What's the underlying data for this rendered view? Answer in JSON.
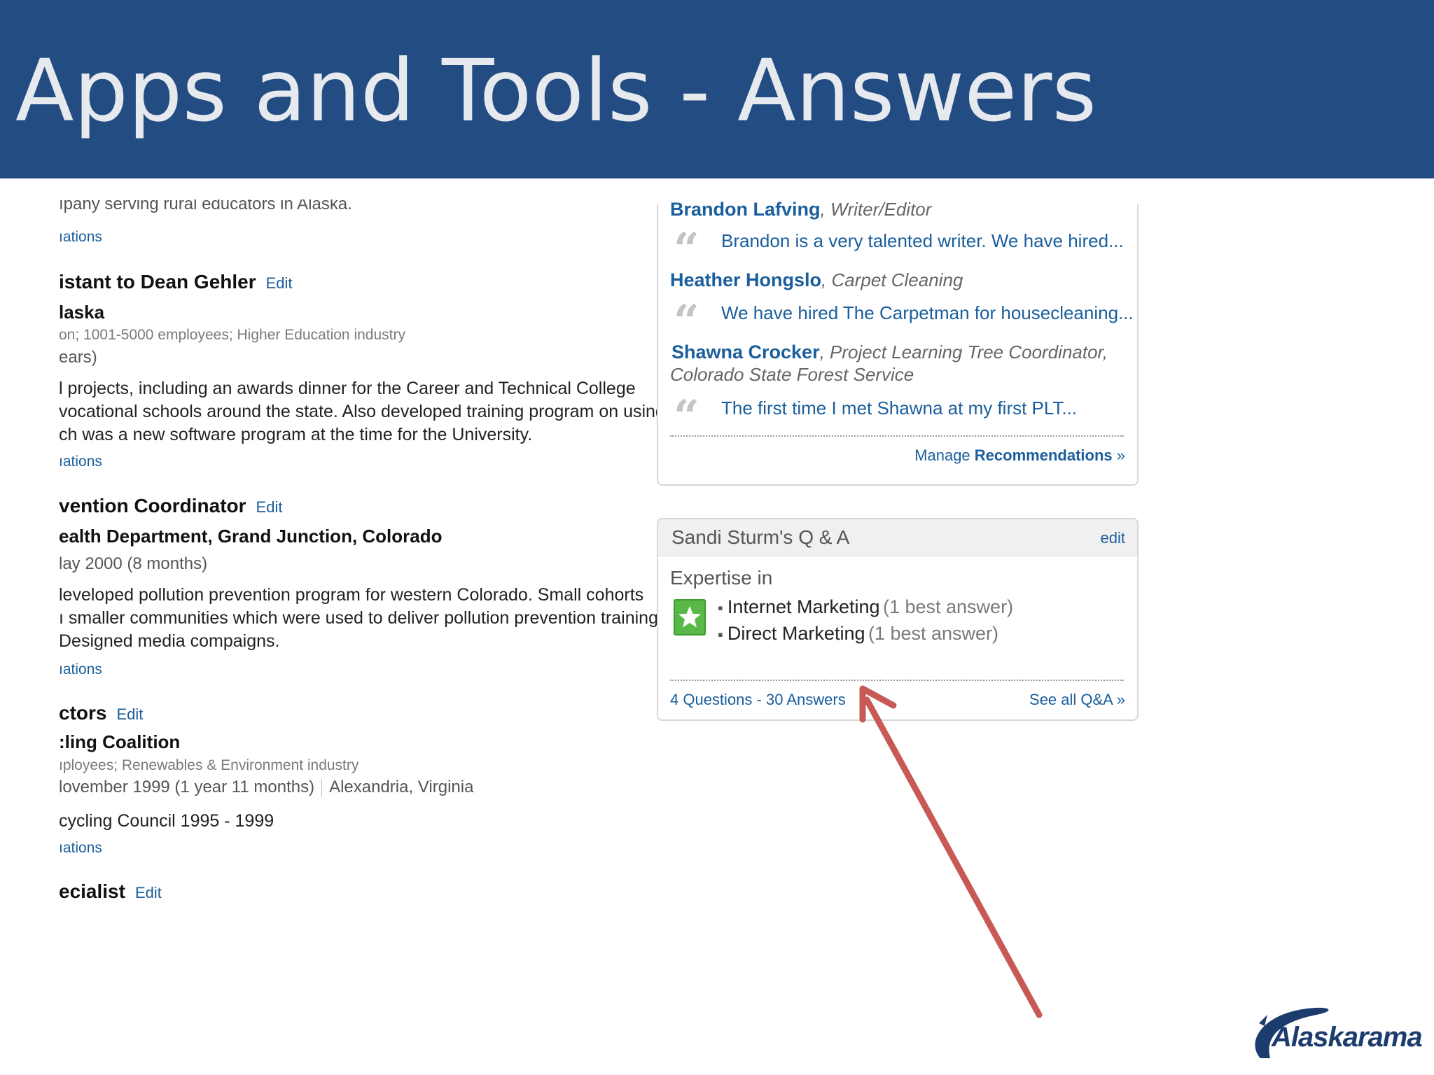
{
  "slide": {
    "title": "Apps and Tools - Answers"
  },
  "experience": [
    {
      "line": "ıpany serving rural educators in Alaska.",
      "link": "ıations"
    },
    {
      "title": "istant to Dean Gehler",
      "edit": "Edit",
      "company": "laska",
      "meta": "on; 1001-5000 employees; Higher Education industry",
      "dates": "ears)",
      "desc": [
        "l projects, including an awards dinner for the Career and Technical College",
        "vocational schools around the state. Also developed training program on using",
        "ch was a new software program at the time for the University."
      ],
      "link": "ıations"
    },
    {
      "title": "vention Coordinator",
      "edit": "Edit",
      "company": "ealth Department, Grand Junction, Colorado",
      "dates": "lay 2000 (8 months)",
      "desc": [
        "leveloped pollution prevention program for western Colorado. Small cohorts",
        "ı smaller communities which were used to deliver pollution prevention training",
        " Designed media compaigns."
      ],
      "link": "ıations"
    },
    {
      "title": "ctors",
      "edit": "Edit",
      "company": ":ling Coalition",
      "meta": "ıployees; Renewables & Environment industry",
      "dates": "lovember 1999 (1 year 11 months)",
      "location": "Alexandria, Virginia",
      "extra": "cycling Council 1995 - 1999",
      "link": "ıations"
    },
    {
      "title": "ecialist",
      "edit": "Edit"
    }
  ],
  "recommendations": {
    "items": [
      {
        "name": "Brandon Lafving",
        "role": "Writer/Editor",
        "quote": "Brandon is a very talented writer. We have hired..."
      },
      {
        "name": "Heather Hongslo",
        "role": "Carpet Cleaning",
        "quote": "We have hired The Carpetman for housecleaning..."
      },
      {
        "name": "Shawna Crocker",
        "role": "Project Learning Tree Coordinator,",
        "role2": "Colorado State Forest Service",
        "quote": "The first time I met Shawna at my first PLT..."
      }
    ],
    "manage_prefix": "Manage",
    "manage_bold": "Recommendations",
    "manage_suffix": "»"
  },
  "qa": {
    "title": "Sandi Sturm's Q & A",
    "edit": "edit",
    "expertise_label": "Expertise in",
    "topics": [
      {
        "name": "Internet Marketing",
        "count": "(1 best answer)"
      },
      {
        "name": "Direct Marketing",
        "count": "(1 best answer)"
      }
    ],
    "questions_label": "4 Questions",
    "sep": " - ",
    "answers_label": "30 Answers",
    "see_all": "See all Q&A »"
  },
  "logo": {
    "text": "Alaskarama"
  },
  "colors": {
    "header": "#234d82",
    "link": "#1a5e9c",
    "arrow": "#c85a55",
    "star": "#58b947"
  },
  "icons": [
    "quote-mark-icon",
    "star-badge-icon",
    "arrow-annotation",
    "alaskarama-logo"
  ]
}
